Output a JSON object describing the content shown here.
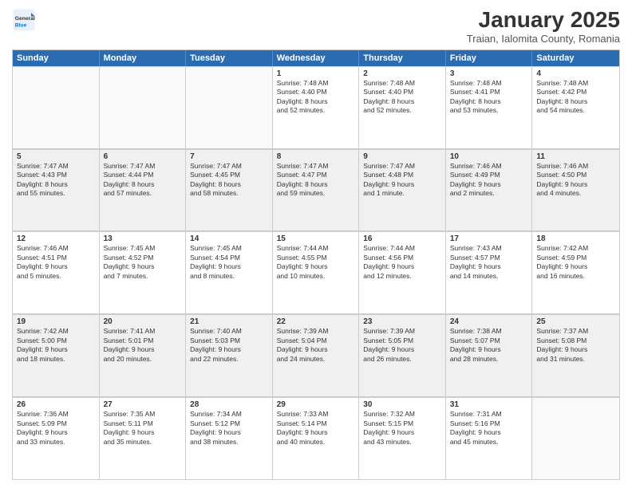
{
  "logo": {
    "general": "General",
    "blue": "Blue"
  },
  "title": "January 2025",
  "subtitle": "Traian, Ialomita County, Romania",
  "days": [
    "Sunday",
    "Monday",
    "Tuesday",
    "Wednesday",
    "Thursday",
    "Friday",
    "Saturday"
  ],
  "weeks": [
    [
      {
        "day": "",
        "content": ""
      },
      {
        "day": "",
        "content": ""
      },
      {
        "day": "",
        "content": ""
      },
      {
        "day": "1",
        "content": "Sunrise: 7:48 AM\nSunset: 4:40 PM\nDaylight: 8 hours\nand 52 minutes."
      },
      {
        "day": "2",
        "content": "Sunrise: 7:48 AM\nSunset: 4:40 PM\nDaylight: 8 hours\nand 52 minutes."
      },
      {
        "day": "3",
        "content": "Sunrise: 7:48 AM\nSunset: 4:41 PM\nDaylight: 8 hours\nand 53 minutes."
      },
      {
        "day": "4",
        "content": "Sunrise: 7:48 AM\nSunset: 4:42 PM\nDaylight: 8 hours\nand 54 minutes."
      }
    ],
    [
      {
        "day": "5",
        "content": "Sunrise: 7:47 AM\nSunset: 4:43 PM\nDaylight: 8 hours\nand 55 minutes."
      },
      {
        "day": "6",
        "content": "Sunrise: 7:47 AM\nSunset: 4:44 PM\nDaylight: 8 hours\nand 57 minutes."
      },
      {
        "day": "7",
        "content": "Sunrise: 7:47 AM\nSunset: 4:45 PM\nDaylight: 8 hours\nand 58 minutes."
      },
      {
        "day": "8",
        "content": "Sunrise: 7:47 AM\nSunset: 4:47 PM\nDaylight: 8 hours\nand 59 minutes."
      },
      {
        "day": "9",
        "content": "Sunrise: 7:47 AM\nSunset: 4:48 PM\nDaylight: 9 hours\nand 1 minute."
      },
      {
        "day": "10",
        "content": "Sunrise: 7:46 AM\nSunset: 4:49 PM\nDaylight: 9 hours\nand 2 minutes."
      },
      {
        "day": "11",
        "content": "Sunrise: 7:46 AM\nSunset: 4:50 PM\nDaylight: 9 hours\nand 4 minutes."
      }
    ],
    [
      {
        "day": "12",
        "content": "Sunrise: 7:46 AM\nSunset: 4:51 PM\nDaylight: 9 hours\nand 5 minutes."
      },
      {
        "day": "13",
        "content": "Sunrise: 7:45 AM\nSunset: 4:52 PM\nDaylight: 9 hours\nand 7 minutes."
      },
      {
        "day": "14",
        "content": "Sunrise: 7:45 AM\nSunset: 4:54 PM\nDaylight: 9 hours\nand 8 minutes."
      },
      {
        "day": "15",
        "content": "Sunrise: 7:44 AM\nSunset: 4:55 PM\nDaylight: 9 hours\nand 10 minutes."
      },
      {
        "day": "16",
        "content": "Sunrise: 7:44 AM\nSunset: 4:56 PM\nDaylight: 9 hours\nand 12 minutes."
      },
      {
        "day": "17",
        "content": "Sunrise: 7:43 AM\nSunset: 4:57 PM\nDaylight: 9 hours\nand 14 minutes."
      },
      {
        "day": "18",
        "content": "Sunrise: 7:42 AM\nSunset: 4:59 PM\nDaylight: 9 hours\nand 16 minutes."
      }
    ],
    [
      {
        "day": "19",
        "content": "Sunrise: 7:42 AM\nSunset: 5:00 PM\nDaylight: 9 hours\nand 18 minutes."
      },
      {
        "day": "20",
        "content": "Sunrise: 7:41 AM\nSunset: 5:01 PM\nDaylight: 9 hours\nand 20 minutes."
      },
      {
        "day": "21",
        "content": "Sunrise: 7:40 AM\nSunset: 5:03 PM\nDaylight: 9 hours\nand 22 minutes."
      },
      {
        "day": "22",
        "content": "Sunrise: 7:39 AM\nSunset: 5:04 PM\nDaylight: 9 hours\nand 24 minutes."
      },
      {
        "day": "23",
        "content": "Sunrise: 7:39 AM\nSunset: 5:05 PM\nDaylight: 9 hours\nand 26 minutes."
      },
      {
        "day": "24",
        "content": "Sunrise: 7:38 AM\nSunset: 5:07 PM\nDaylight: 9 hours\nand 28 minutes."
      },
      {
        "day": "25",
        "content": "Sunrise: 7:37 AM\nSunset: 5:08 PM\nDaylight: 9 hours\nand 31 minutes."
      }
    ],
    [
      {
        "day": "26",
        "content": "Sunrise: 7:36 AM\nSunset: 5:09 PM\nDaylight: 9 hours\nand 33 minutes."
      },
      {
        "day": "27",
        "content": "Sunrise: 7:35 AM\nSunset: 5:11 PM\nDaylight: 9 hours\nand 35 minutes."
      },
      {
        "day": "28",
        "content": "Sunrise: 7:34 AM\nSunset: 5:12 PM\nDaylight: 9 hours\nand 38 minutes."
      },
      {
        "day": "29",
        "content": "Sunrise: 7:33 AM\nSunset: 5:14 PM\nDaylight: 9 hours\nand 40 minutes."
      },
      {
        "day": "30",
        "content": "Sunrise: 7:32 AM\nSunset: 5:15 PM\nDaylight: 9 hours\nand 43 minutes."
      },
      {
        "day": "31",
        "content": "Sunrise: 7:31 AM\nSunset: 5:16 PM\nDaylight: 9 hours\nand 45 minutes."
      },
      {
        "day": "",
        "content": ""
      }
    ]
  ]
}
